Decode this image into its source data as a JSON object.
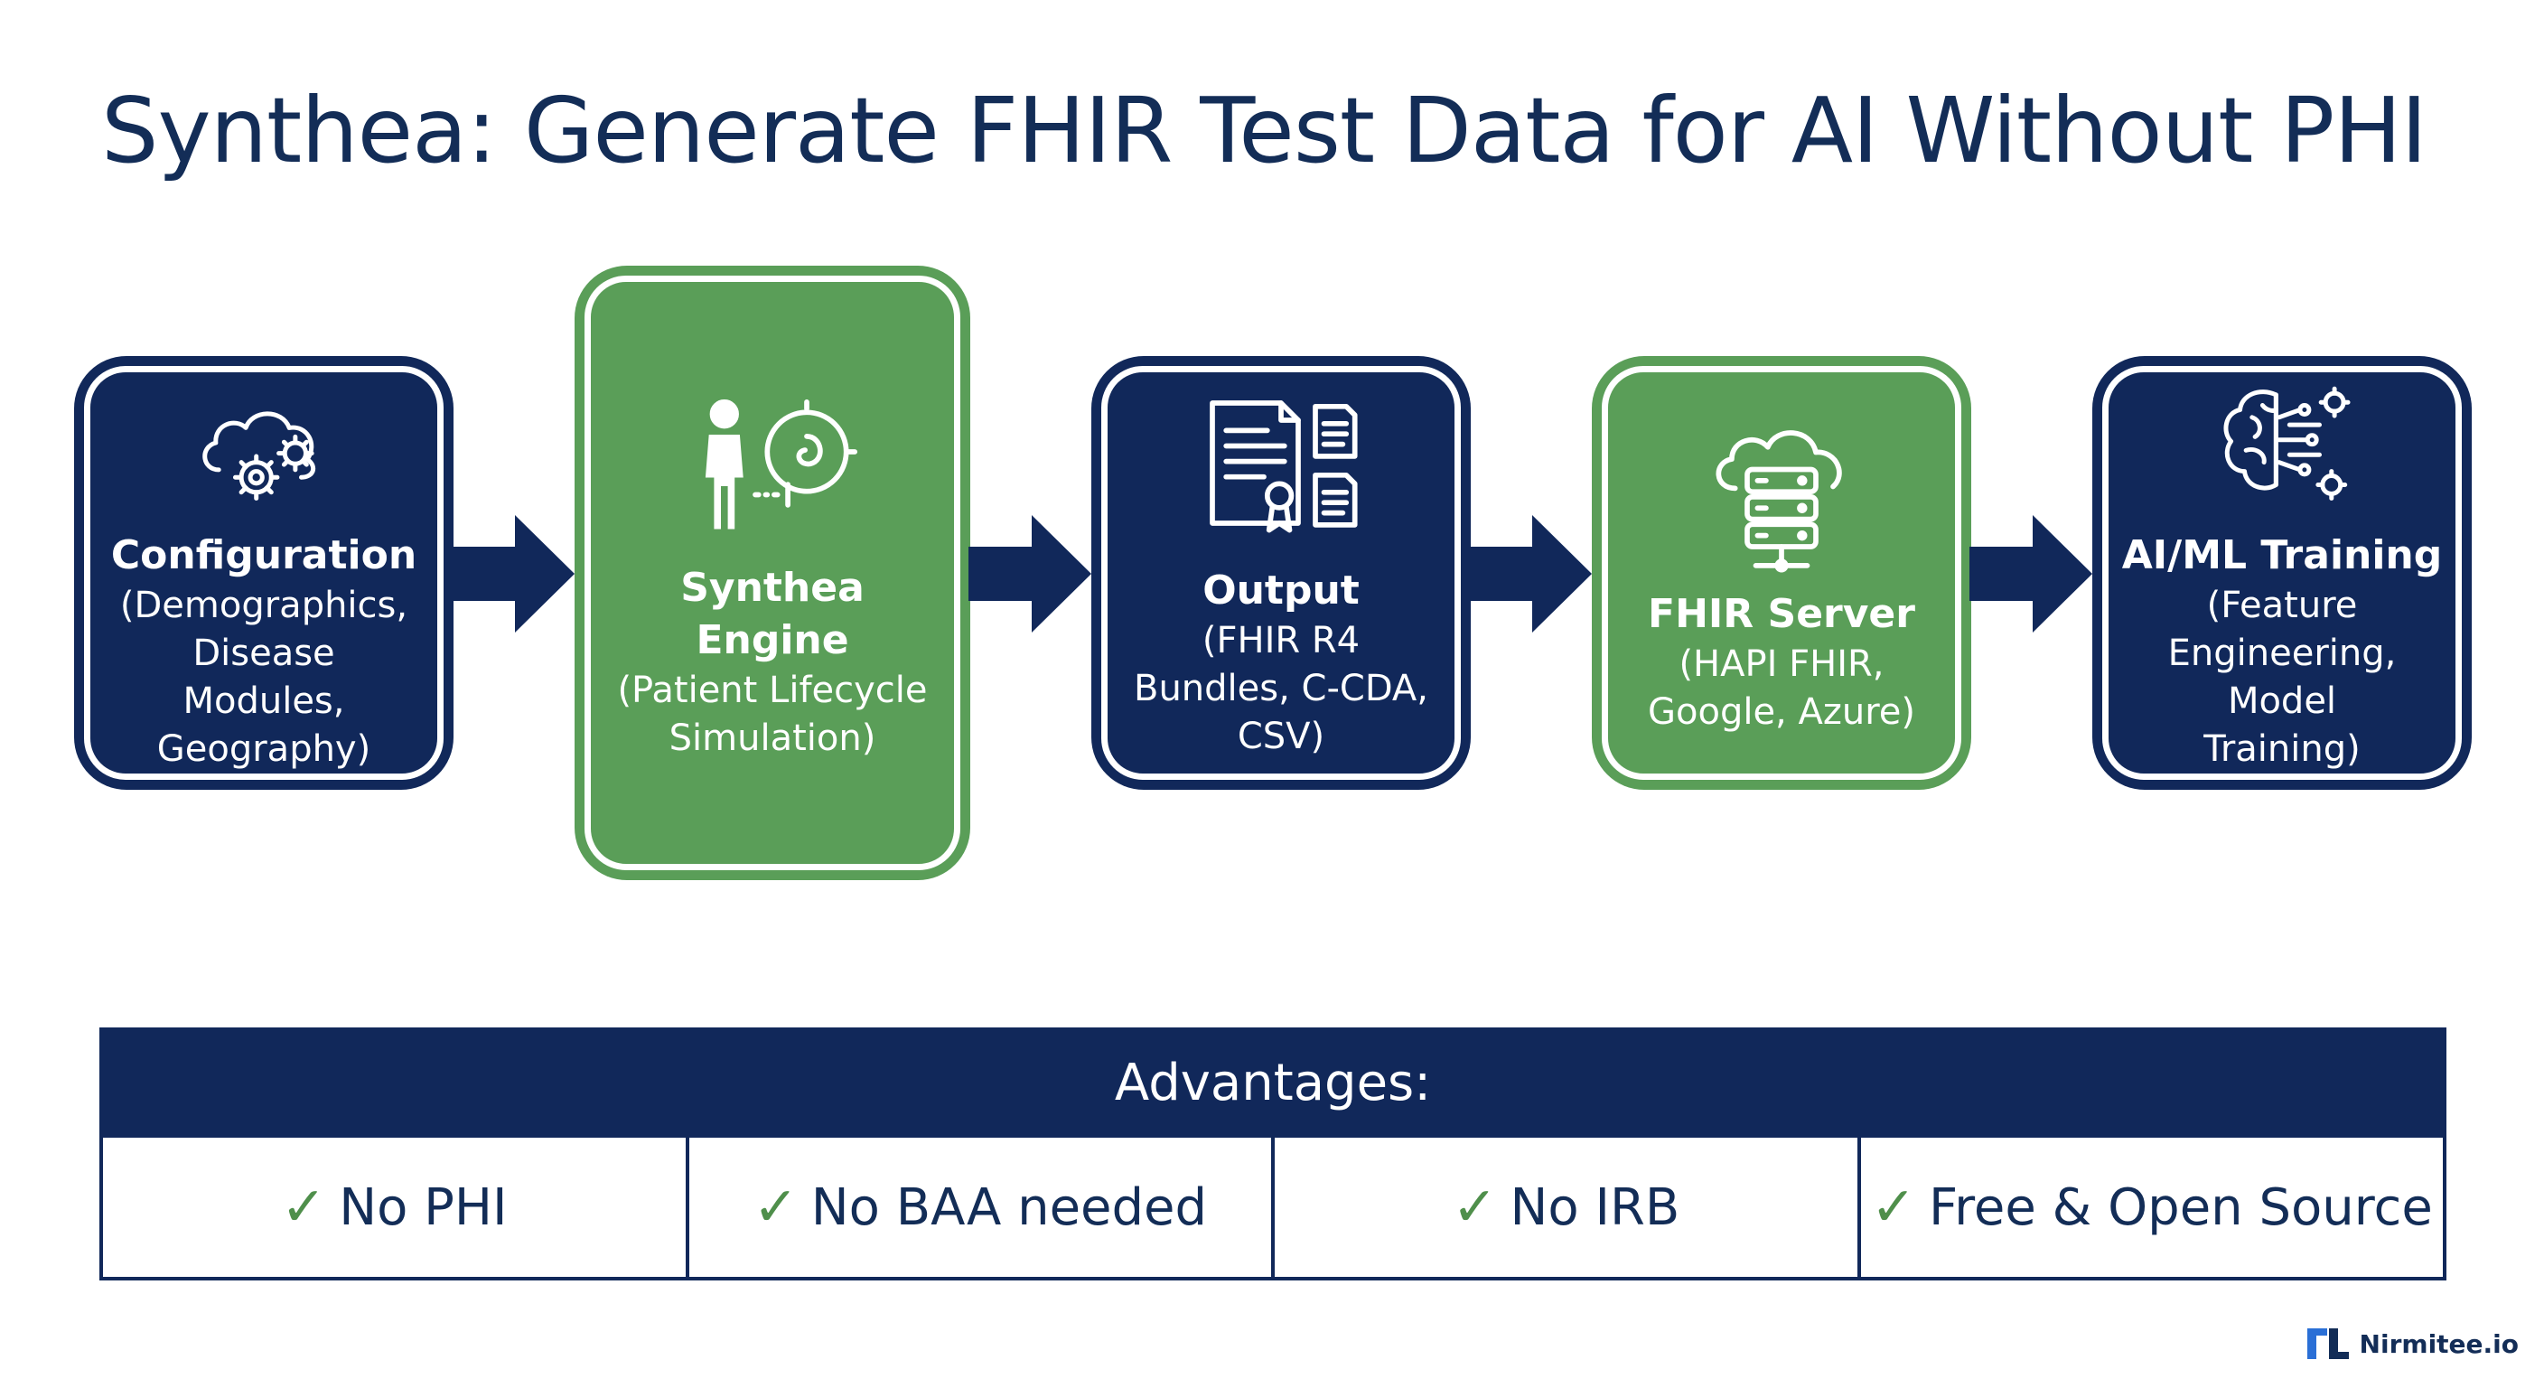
{
  "title": "Synthea: Generate FHIR Test Data for AI Without PHI",
  "steps": [
    {
      "name": "Configuration",
      "desc": "(Demographics, Disease Modules, Geography)",
      "icon": "cloud-gears-icon"
    },
    {
      "name": "Synthea Engine",
      "desc": "(Patient Lifecycle Simulation)",
      "icon": "person-lifecycle-icon"
    },
    {
      "name": "Output",
      "desc": "(FHIR R4 Bundles, C-CDA, CSV)",
      "icon": "documents-icon"
    },
    {
      "name": "FHIR Server",
      "desc": "(HAPI FHIR, Google, Azure)",
      "icon": "cloud-server-icon"
    },
    {
      "name": "AI/ML Training",
      "desc": "(Feature Engineering, Model Training)",
      "icon": "brain-network-icon"
    }
  ],
  "advantages": {
    "header": "Advantages:",
    "items": [
      "No PHI",
      "No BAA needed",
      "No IRB",
      "Free & Open Source"
    ],
    "check_symbol": "✓"
  },
  "brand": {
    "name": "Nirmitee.io"
  },
  "colors": {
    "navy": "#11285a",
    "green": "#5a9e58",
    "check": "#4f8f4b"
  }
}
